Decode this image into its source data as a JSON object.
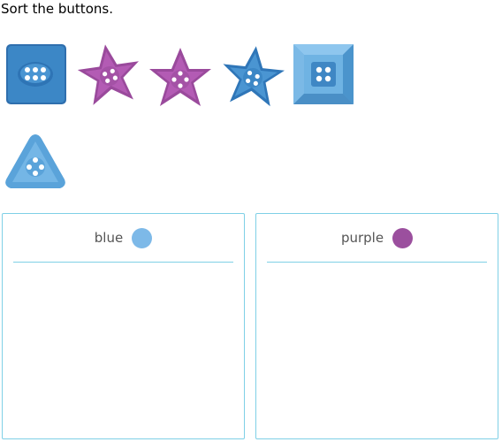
{
  "prompt": "Sort the buttons.",
  "buttons": [
    {
      "shape": "rounded-square",
      "color": "blue",
      "holes": 6
    },
    {
      "shape": "star",
      "color": "purple",
      "holes": 4
    },
    {
      "shape": "star",
      "color": "purple",
      "holes": 4
    },
    {
      "shape": "star",
      "color": "blue",
      "holes": 4
    },
    {
      "shape": "square",
      "color": "blue",
      "holes": 4
    },
    {
      "shape": "triangle",
      "color": "blue",
      "holes": 4
    }
  ],
  "bins": [
    {
      "label": "blue",
      "swatch_color": "#7db9e8"
    },
    {
      "label": "purple",
      "swatch_color": "#9b4f9e"
    }
  ],
  "colors": {
    "border": "#7fd0e6",
    "blue": "#3c87c6",
    "light_blue": "#6fb3e3",
    "purple": "#a855a8"
  }
}
